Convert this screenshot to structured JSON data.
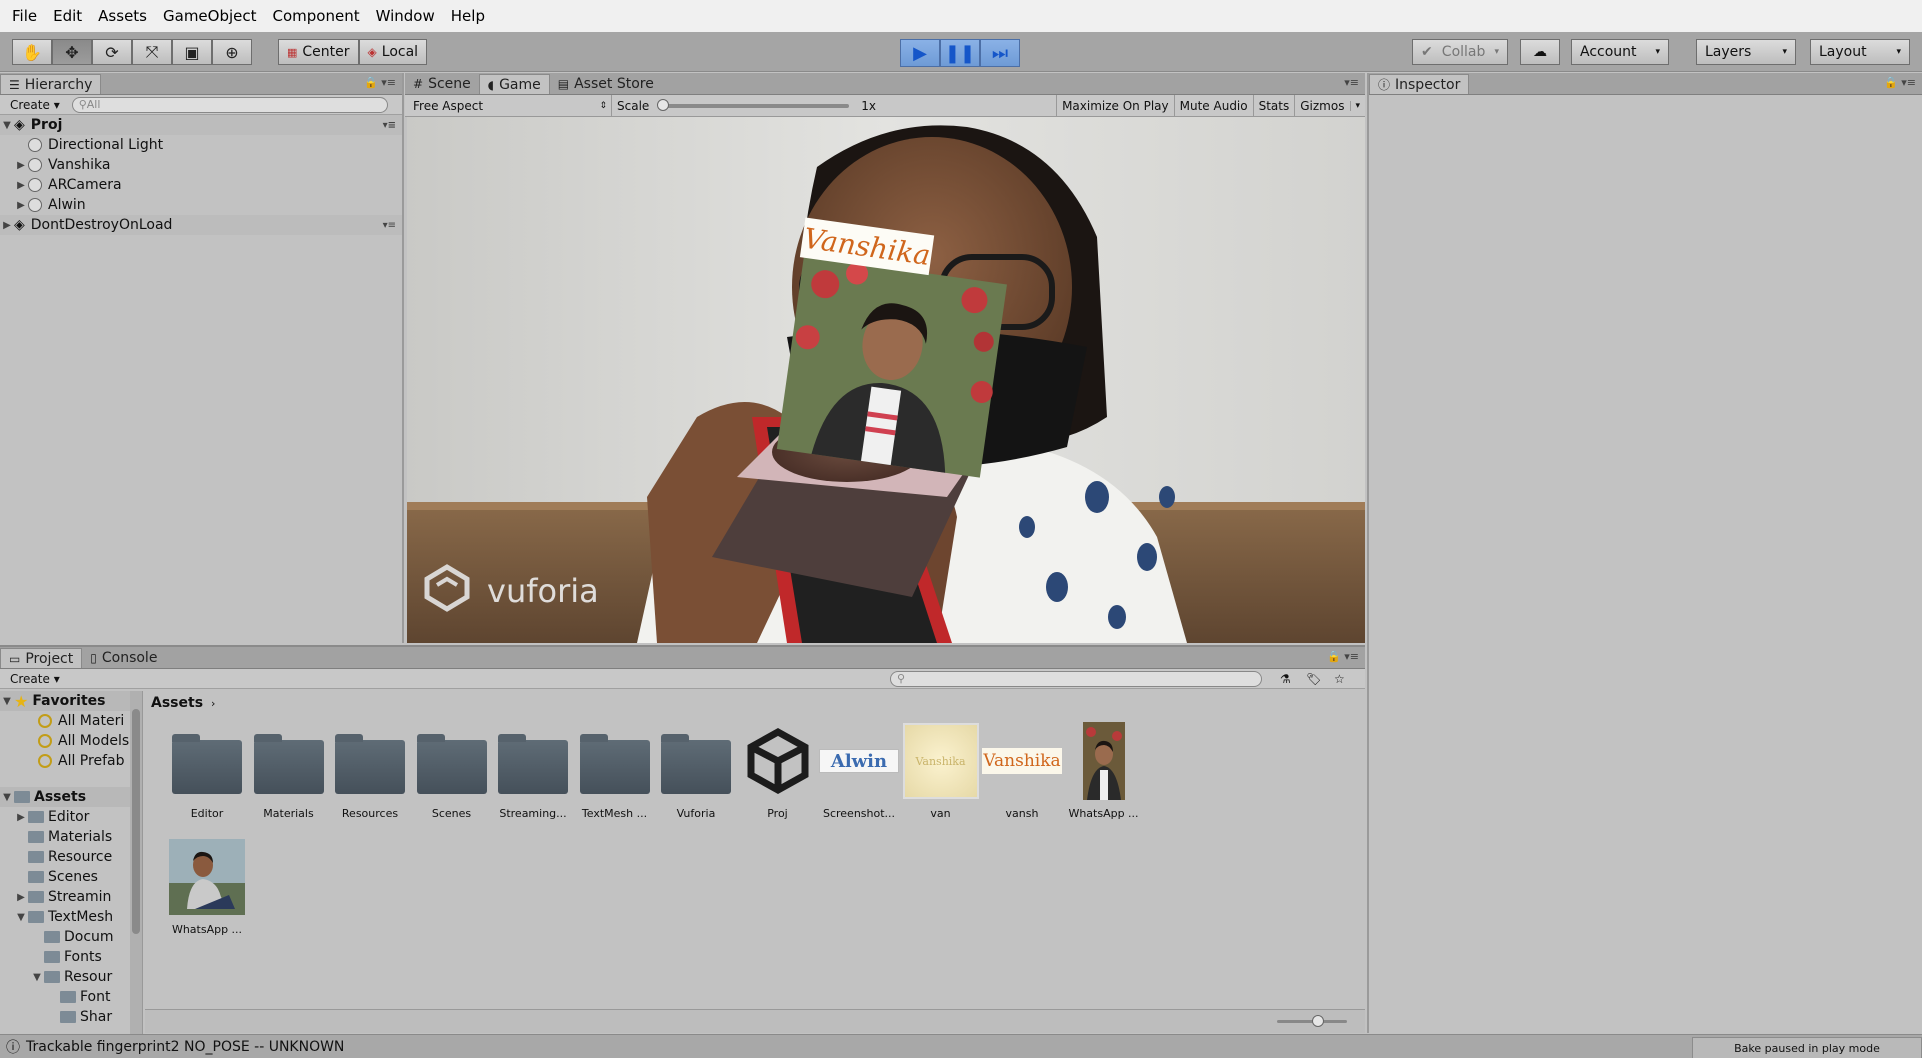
{
  "menubar": {
    "items": [
      "File",
      "Edit",
      "Assets",
      "GameObject",
      "Component",
      "Window",
      "Help"
    ]
  },
  "toolbar": {
    "tools": [
      "hand-icon",
      "move-icon",
      "rotate-icon",
      "scale-icon",
      "rect-icon",
      "transform-icon"
    ],
    "active_tool_index": 1,
    "pivot_label": "Center",
    "space_label": "Local",
    "collab_label": "Collab",
    "account_label": "Account",
    "layers_label": "Layers",
    "layout_label": "Layout",
    "play_active": true
  },
  "hierarchy": {
    "tab_label": "Hierarchy",
    "create_label": "Create",
    "search_placeholder": "All",
    "scene_name": "Proj",
    "objects": [
      "Directional Light",
      "Vanshika",
      "ARCamera",
      "Alwin"
    ],
    "dont_destroy_label": "DontDestroyOnLoad"
  },
  "gameview": {
    "tabs": [
      "Scene",
      "Game",
      "Asset Store"
    ],
    "active_tab": "Game",
    "aspect_label": "Free Aspect",
    "scale_label": "Scale",
    "scale_value": "1x",
    "maximize_label": "Maximize On Play",
    "mute_label": "Mute Audio",
    "stats_label": "Stats",
    "gizmos_label": "Gizmos",
    "ar_label_text": "Vanshika",
    "watermark": "vuforia"
  },
  "inspector": {
    "tab_label": "Inspector"
  },
  "project": {
    "tabs": [
      "Project",
      "Console"
    ],
    "create_label": "Create",
    "favorites_label": "Favorites",
    "favorites": [
      "All Materi",
      "All Models",
      "All Prefab"
    ],
    "assets_root": "Assets",
    "tree": [
      {
        "label": "Editor",
        "indent": 1,
        "arrow": "▶"
      },
      {
        "label": "Materials",
        "indent": 1,
        "arrow": ""
      },
      {
        "label": "Resource",
        "indent": 1,
        "arrow": ""
      },
      {
        "label": "Scenes",
        "indent": 1,
        "arrow": ""
      },
      {
        "label": "Streamin",
        "indent": 1,
        "arrow": "▶"
      },
      {
        "label": "TextMesh",
        "indent": 1,
        "arrow": "▼"
      },
      {
        "label": "Docum",
        "indent": 2,
        "arrow": ""
      },
      {
        "label": "Fonts",
        "indent": 2,
        "arrow": ""
      },
      {
        "label": "Resour",
        "indent": 2,
        "arrow": "▼"
      },
      {
        "label": "Font",
        "indent": 3,
        "arrow": ""
      },
      {
        "label": "Shar",
        "indent": 3,
        "arrow": ""
      }
    ],
    "breadcrumb": "Assets",
    "assets": [
      {
        "label": "Editor",
        "type": "folder"
      },
      {
        "label": "Materials",
        "type": "folder"
      },
      {
        "label": "Resources",
        "type": "folder"
      },
      {
        "label": "Scenes",
        "type": "folder"
      },
      {
        "label": "Streaming...",
        "type": "folder"
      },
      {
        "label": "TextMesh ...",
        "type": "folder"
      },
      {
        "label": "Vuforia",
        "type": "folder"
      },
      {
        "label": "Proj",
        "type": "unity"
      },
      {
        "label": "Screenshot...",
        "type": "text-alwin"
      },
      {
        "label": "van",
        "type": "van"
      },
      {
        "label": "vansh",
        "type": "text-vanshika"
      },
      {
        "label": "WhatsApp ...",
        "type": "photo-portrait"
      },
      {
        "label": "WhatsApp ...",
        "type": "photo-sitting"
      }
    ],
    "alwin_text": "Alwin",
    "vanshika_text": "Vanshika",
    "van_text": "Vanshika"
  },
  "statusbar": {
    "message": "Trackable fingerprint2 NO_POSE -- UNKNOWN",
    "bake_status": "Bake paused in play mode"
  },
  "colors": {
    "play_blue": "#1556c9",
    "panel_bg": "#c2c2c2",
    "toolbar_bg": "#a5a5a5",
    "folder_color": "#53606a",
    "label_orange": "#d0661c"
  }
}
